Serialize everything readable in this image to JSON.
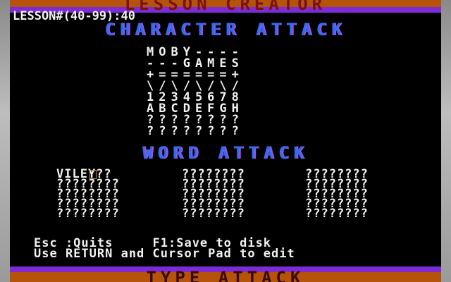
{
  "app": {
    "title_top": "LESSON CREATOR",
    "title_bottom": "TYPE ATTACK"
  },
  "lesson": {
    "label": "LESSON#(40-99):40"
  },
  "character_attack": {
    "heading": "CHARACTER ATTACK",
    "rows": [
      "MOBY----",
      "---GAMES",
      "+======+",
      "\\/\\/\\/\\/",
      "12345678",
      "ABCDEFGH",
      "????????",
      "????????"
    ]
  },
  "word_attack": {
    "heading": "WORD ATTACK",
    "columns": [
      [
        "VILEY???",
        "????????",
        "????????",
        "????????",
        "????????"
      ],
      [
        "????????",
        "????????",
        "????????",
        "????????",
        "????????"
      ],
      [
        "????????",
        "????????",
        "????????",
        "????????",
        "????????"
      ]
    ],
    "first_entry_before_cursor": "VILEY",
    "first_entry_after_cursor": "??"
  },
  "footer": {
    "line1": "Esc :Quits     F1:Save to disk",
    "line2": "Use RETURN and Cursor Pad to edit"
  },
  "colors": {
    "heading": "#2f6df0",
    "heading_shadow": "#b04ce0",
    "band_orange": "#b45309",
    "band_purple": "#7c2bd6",
    "cursor": "#d08a2a"
  }
}
